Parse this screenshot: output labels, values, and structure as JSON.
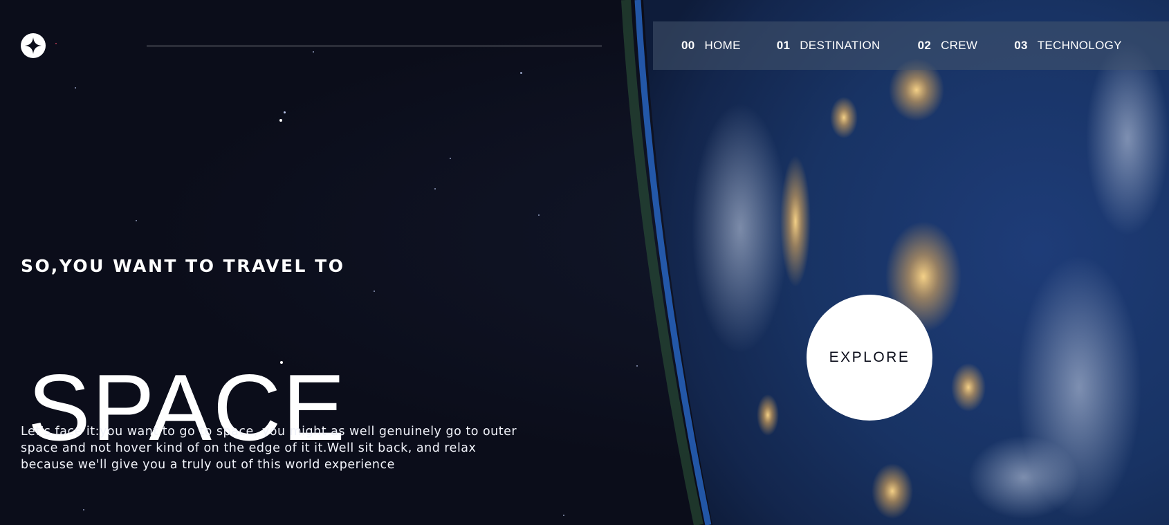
{
  "nav": {
    "items": [
      {
        "num": "00",
        "label": "HOME"
      },
      {
        "num": "01",
        "label": "DESTINATION"
      },
      {
        "num": "02",
        "label": "CREW"
      },
      {
        "num": "03",
        "label": "TECHNOLOGY"
      }
    ]
  },
  "hero": {
    "eyebrow": "SO,YOU WANT TO TRAVEL TO",
    "title": "SPACE",
    "description": "Let's face it:you want to go to space, you might as well genuinely go to outer space and not hover kind of on the edge of it it.Well sit back, and relax because we'll give you a truly out of this world experience",
    "explore_label": "EXPLORE"
  },
  "icons": {
    "logo": "four-point-star-icon"
  },
  "colors": {
    "background": "#0b0d1a",
    "nav_bg": "rgba(70,85,110,0.55)",
    "accent": "#ffffff"
  }
}
